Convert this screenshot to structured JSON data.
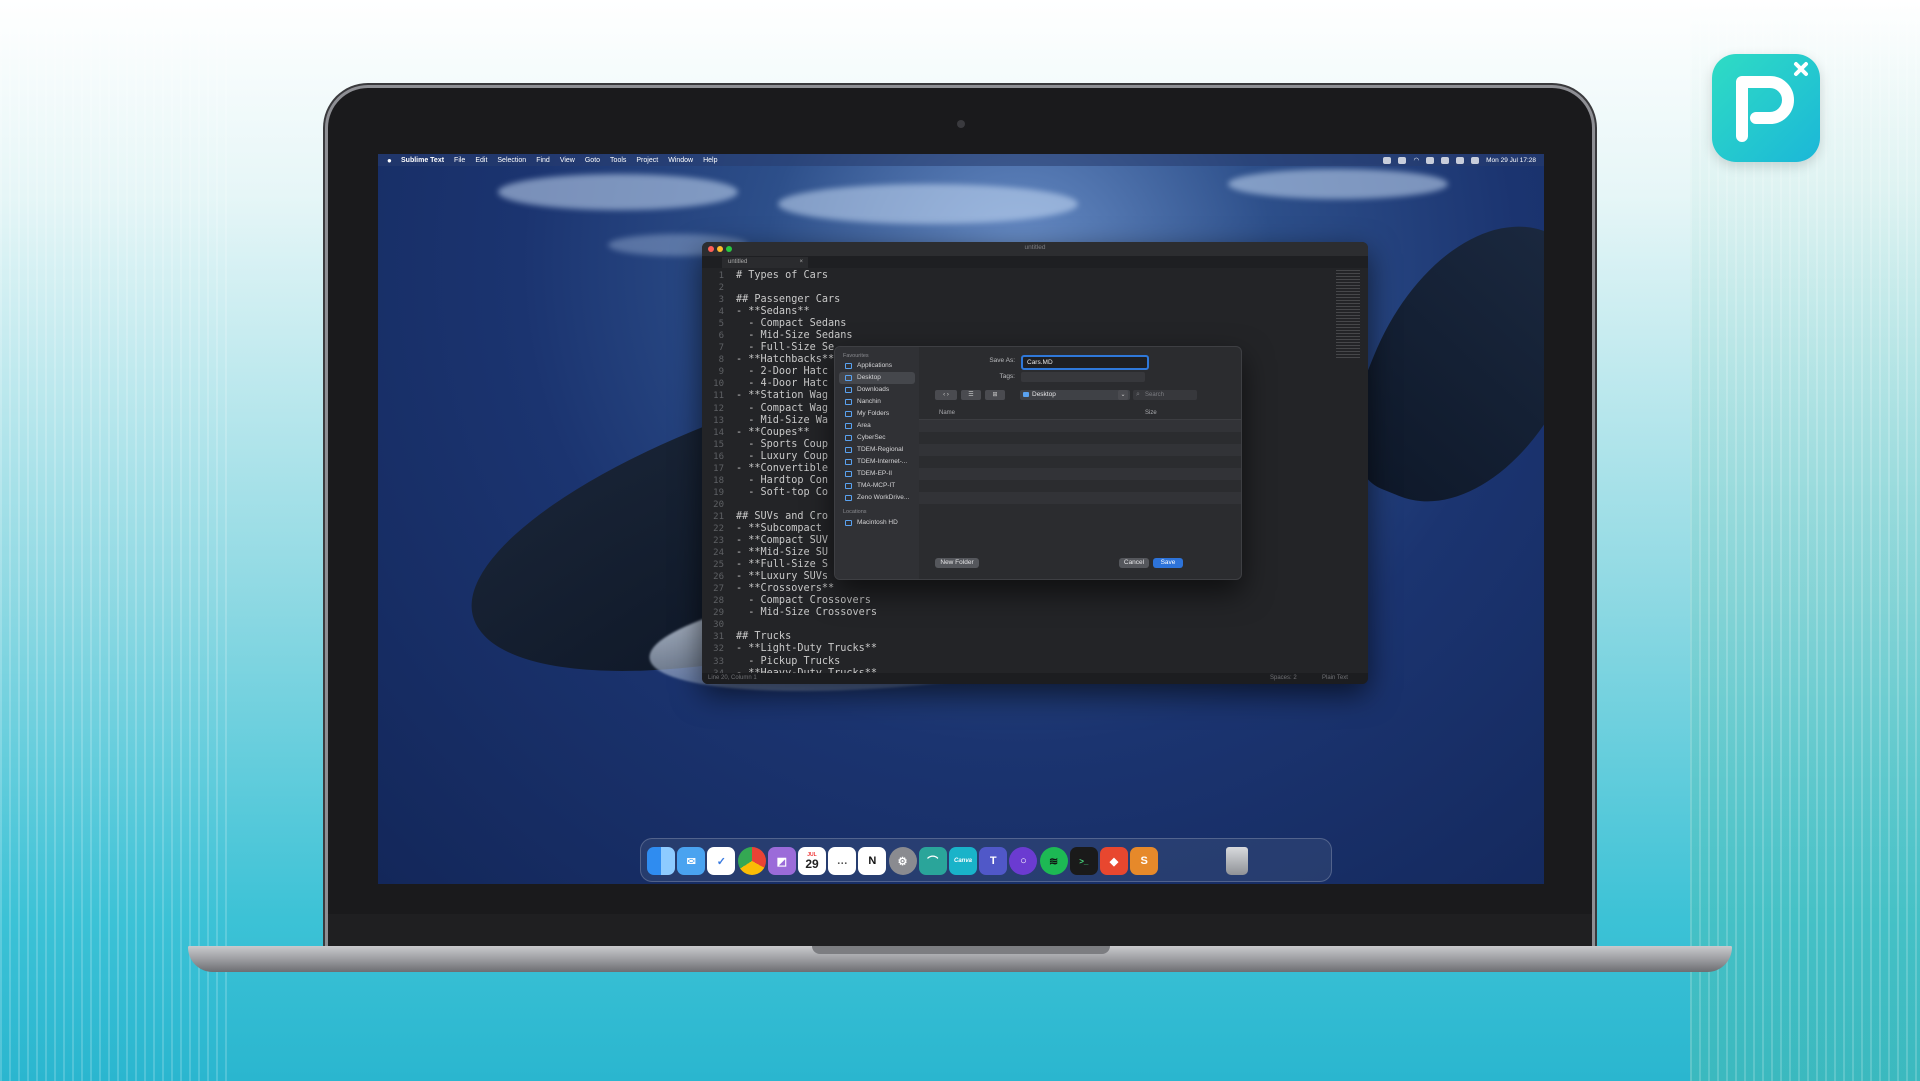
{
  "menubar": {
    "app_name": "Sublime Text",
    "items": [
      "File",
      "Edit",
      "Selection",
      "Find",
      "View",
      "Goto",
      "Tools",
      "Project",
      "Window",
      "Help"
    ],
    "clock": "Mon 29 Jul  17:28"
  },
  "editor": {
    "window_title": "untitled",
    "tab_label": "untitled",
    "lines": [
      "# Types of Cars",
      "",
      "## Passenger Cars",
      "- **Sedans**",
      "  - Compact Sedans",
      "  - Mid-Size Sedans",
      "  - Full-Size Se",
      "- **Hatchbacks**",
      "  - 2-Door Hatc",
      "  - 4-Door Hatc",
      "- **Station Wag",
      "  - Compact Wag",
      "  - Mid-Size Wa",
      "- **Coupes**",
      "  - Sports Coup",
      "  - Luxury Coup",
      "- **Convertible",
      "  - Hardtop Con",
      "  - Soft-top Co",
      "",
      "## SUVs and Cro",
      "- **Subcompact",
      "- **Compact SUV",
      "- **Mid-Size SU",
      "- **Full-Size S",
      "- **Luxury SUVs",
      "- **Crossovers**",
      "  - Compact Crossovers",
      "  - Mid-Size Crossovers",
      "",
      "## Trucks",
      "- **Light-Duty Trucks**",
      "  - Pickup Trucks",
      "- **Heavy-Duty Trucks**"
    ],
    "status_left": "Line 20, Column 1",
    "status_spaces": "Spaces: 2",
    "status_syntax": "Plain Text"
  },
  "dialog": {
    "sidebar_favourites": "Favourites",
    "sidebar_items": [
      "Applications",
      "Desktop",
      "Downloads",
      "Nanchin",
      "My Folders",
      "Area",
      "CyberSec",
      "TDEM-Regional",
      "TDEM-Internet-...",
      "TDEM-EP-II",
      "TMA-MCP-IT",
      "Zeno WorkDrive..."
    ],
    "sidebar_locations": "Locations",
    "sidebar_location_item": "Macintosh HD",
    "save_as_label": "Save As:",
    "save_as_value": "Cars.MD",
    "tags_label": "Tags:",
    "location": "Desktop",
    "search_placeholder": "Search",
    "col_name": "Name",
    "col_size": "Size",
    "new_folder": "New Folder",
    "cancel": "Cancel",
    "save": "Save"
  },
  "dock": {
    "calendar_month": "JUL",
    "calendar_day": "29",
    "canva_label": "Canva",
    "icons": [
      "finder-icon",
      "mail-icon",
      "things-icon",
      "chrome-icon",
      "preview-icon",
      "calendar-icon",
      "messages-icon",
      "notion-icon",
      "settings-icon",
      "arc-icon",
      "canva-icon",
      "teams-icon",
      "omnifocus-icon",
      "spotify-icon",
      "terminal-icon",
      "affinity-icon",
      "sublime-icon",
      "trash-icon"
    ]
  },
  "colors": {
    "accent": "#2d73d9",
    "editor_bg": "#232427",
    "brand_teal": "#1bb7d8"
  }
}
